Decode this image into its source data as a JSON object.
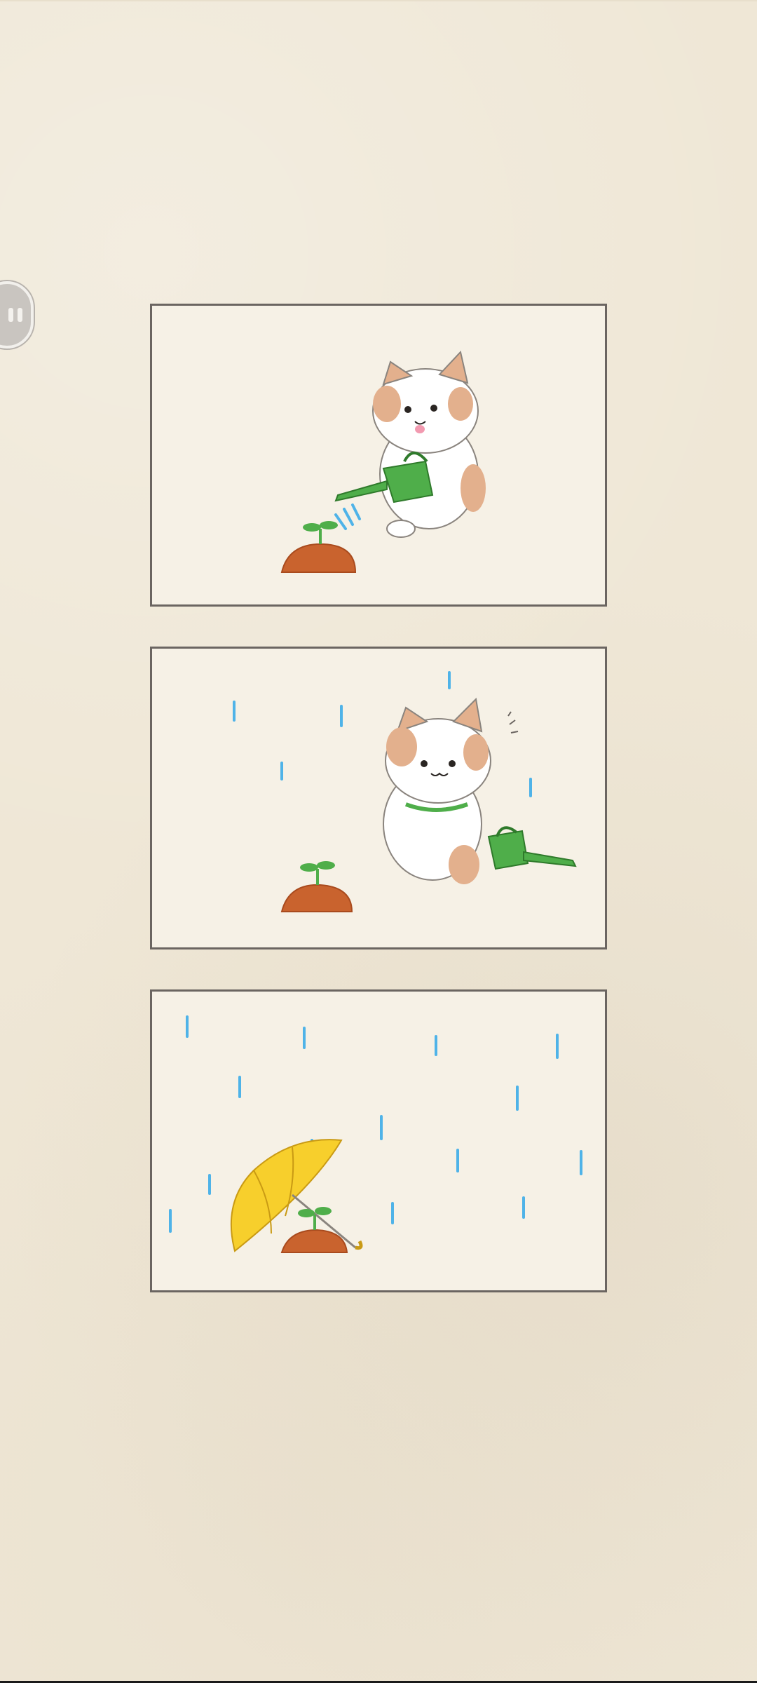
{
  "app": {
    "type": "comic-strip-game"
  },
  "controls": {
    "pause_icon": "pause-icon"
  },
  "panels": [
    {
      "scene": "cat-watering-sprout"
    },
    {
      "scene": "cat-looking-at-rain"
    },
    {
      "scene": "umbrella-over-sprout-in-rain"
    }
  ],
  "colors": {
    "background": "#efe7d6",
    "panel_border": "#6b6561",
    "rain": "#4fb3e8",
    "umbrella": "#f7cf2c",
    "watering_can": "#4fae4a",
    "soil": "#c9632e",
    "cat_patch": "#e3b08d"
  }
}
